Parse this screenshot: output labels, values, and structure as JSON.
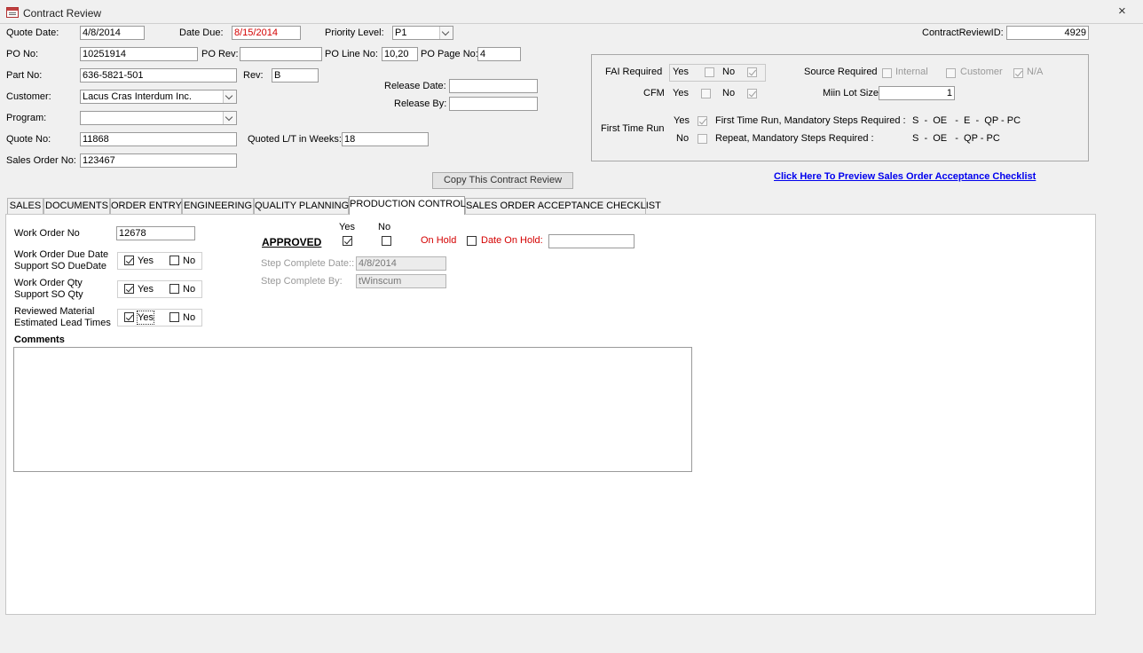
{
  "window": {
    "title": "Contract Review",
    "close_label": "×"
  },
  "header": {
    "quote_date_label": "Quote Date:",
    "quote_date": "4/8/2014",
    "date_due_label": "Date Due:",
    "date_due": "8/15/2014",
    "priority_label": "Priority Level:",
    "priority": "P1",
    "review_id_label": "ContractReviewID:",
    "review_id": "4929",
    "po_no_label": "PO No:",
    "po_no": "10251914",
    "po_rev_label": "PO Rev:",
    "po_rev": "",
    "po_line_label": "PO Line No:",
    "po_line": "10,20",
    "po_page_label": "PO Page No:",
    "po_page": "4",
    "part_no_label": "Part No:",
    "part_no": "636-5821-501",
    "rev_label": "Rev:",
    "rev": "B",
    "customer_label": "Customer:",
    "customer": "Lacus Cras Interdum Inc.",
    "program_label": "Program:",
    "program": "",
    "release_date_label": "Release Date:",
    "release_date": "",
    "release_by_label": "Release By:",
    "release_by": "",
    "quote_no_label": "Quote No:",
    "quote_no": "11868",
    "quoted_lt_label": "Quoted L/T in Weeks:",
    "quoted_lt": "18",
    "sales_order_label": "Sales Order No:",
    "sales_order": "123467",
    "copy_button": "Copy This Contract Review",
    "preview_link": "Click Here To Preview Sales Order Acceptance Checklist"
  },
  "requirements": {
    "fai_label": "FAI Required",
    "cfm_label": "CFM",
    "yes": "Yes",
    "no": "No",
    "source_label": "Source Required",
    "internal": "Internal",
    "customer": "Customer",
    "na": "N/A",
    "min_lot_label": "Miin Lot Size",
    "min_lot": "1",
    "first_time_label": "First Time Run",
    "ftr_yes_text": "First Time Run, Mandatory Steps Required :",
    "ftr_yes_steps": "S  -  OE   -  E  -  QP - PC",
    "ftr_no_text": "Repeat, Mandatory Steps Required :",
    "ftr_no_steps": "S  -  OE   -  QP - PC"
  },
  "tabs": [
    {
      "label": "SALES"
    },
    {
      "label": "DOCUMENTS"
    },
    {
      "label": "ORDER ENTRY"
    },
    {
      "label": "ENGINEERING"
    },
    {
      "label": "QUALITY PLANNING"
    },
    {
      "label": "PRODUCTION CONTROL"
    },
    {
      "label": "SALES ORDER ACCEPTANCE CHECKLIST"
    }
  ],
  "production": {
    "work_order_label": "Work Order No",
    "work_order": "12678",
    "wo_due_label_1": "Work Order Due Date",
    "wo_due_label_2": "Support SO DueDate",
    "wo_qty_label_1": "Work Order Qty",
    "wo_qty_label_2": "Support SO Qty",
    "material_label_1": "Reviewed Material",
    "material_label_2": "Estimated Lead Times",
    "yes": "Yes",
    "no": "No",
    "comments_label": "Comments",
    "comments": "",
    "approved_label": "APPROVED",
    "on_hold_label": "On Hold",
    "date_on_hold_label": "Date On Hold:",
    "date_on_hold": "",
    "step_date_label": "Step Complete Date::",
    "step_date": "4/8/2014",
    "step_by_label": "Step Complete By:",
    "step_by": "tWinscum"
  },
  "colors": {
    "red_text": "#d40000",
    "link": "#0000ee"
  }
}
